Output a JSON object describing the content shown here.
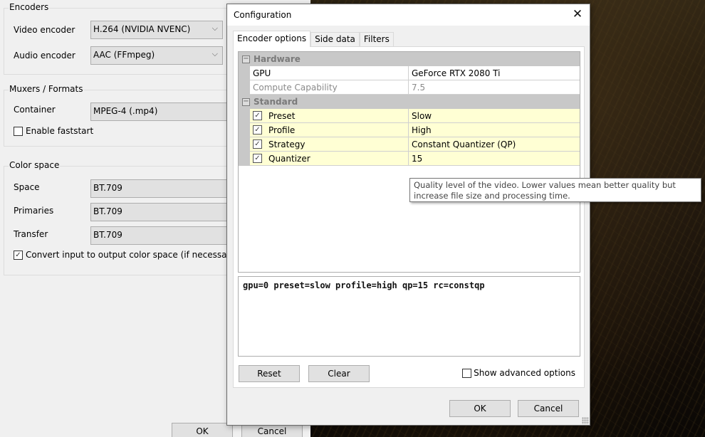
{
  "left_panel": {
    "encoders": {
      "legend": "Encoders",
      "video_encoder_label": "Video encoder",
      "video_encoder_value": "H.264 (NVIDIA NVENC)",
      "audio_encoder_label": "Audio encoder",
      "audio_encoder_value": "AAC (FFmpeg)"
    },
    "muxers": {
      "legend": "Muxers / Formats",
      "container_label": "Container",
      "container_value": "MPEG-4 (.mp4)",
      "faststart_label": "Enable faststart",
      "faststart_checked": false
    },
    "color_space": {
      "legend": "Color space",
      "space_label": "Space",
      "space_value": "BT.709",
      "primaries_label": "Primaries",
      "primaries_value": "BT.709",
      "transfer_label": "Transfer",
      "transfer_value": "BT.709",
      "convert_label": "Convert input to output color space (if necessary)",
      "convert_checked": true
    },
    "ok_label": "OK",
    "cancel_label": "Cancel"
  },
  "dialog": {
    "title": "Configuration",
    "close_icon": "close-icon",
    "tabs": [
      {
        "label": "Encoder options",
        "active": true
      },
      {
        "label": "Side data",
        "active": false
      },
      {
        "label": "Filters",
        "active": false
      }
    ],
    "grid": {
      "categories": [
        {
          "name": "Hardware",
          "expanded": true,
          "rows": [
            {
              "name": "GPU",
              "value": "GeForce RTX 2080 Ti",
              "enabled": true
            },
            {
              "name": "Compute Capability",
              "value": "7.5",
              "enabled": false
            }
          ]
        },
        {
          "name": "Standard",
          "expanded": true,
          "rows": [
            {
              "name": "Preset",
              "value": "Slow",
              "checked": true
            },
            {
              "name": "Profile",
              "value": "High",
              "checked": true
            },
            {
              "name": "Strategy",
              "value": "Constant Quantizer (QP)",
              "checked": true
            },
            {
              "name": "Quantizer",
              "value": "15",
              "checked": true
            }
          ]
        }
      ]
    },
    "tooltip": "Quality level of the video. Lower values mean better quality but increase file size and processing time.",
    "options_string": "gpu=0 preset=slow profile=high qp=15 rc=constqp",
    "reset_label": "Reset",
    "clear_label": "Clear",
    "show_advanced_label": "Show advanced options",
    "show_advanced_checked": false,
    "ok_label": "OK",
    "cancel_label": "Cancel"
  },
  "colors": {
    "highlight_row": "#ffffd4",
    "category_row": "#c8c8c8",
    "window_bg": "#f0f0f0"
  }
}
